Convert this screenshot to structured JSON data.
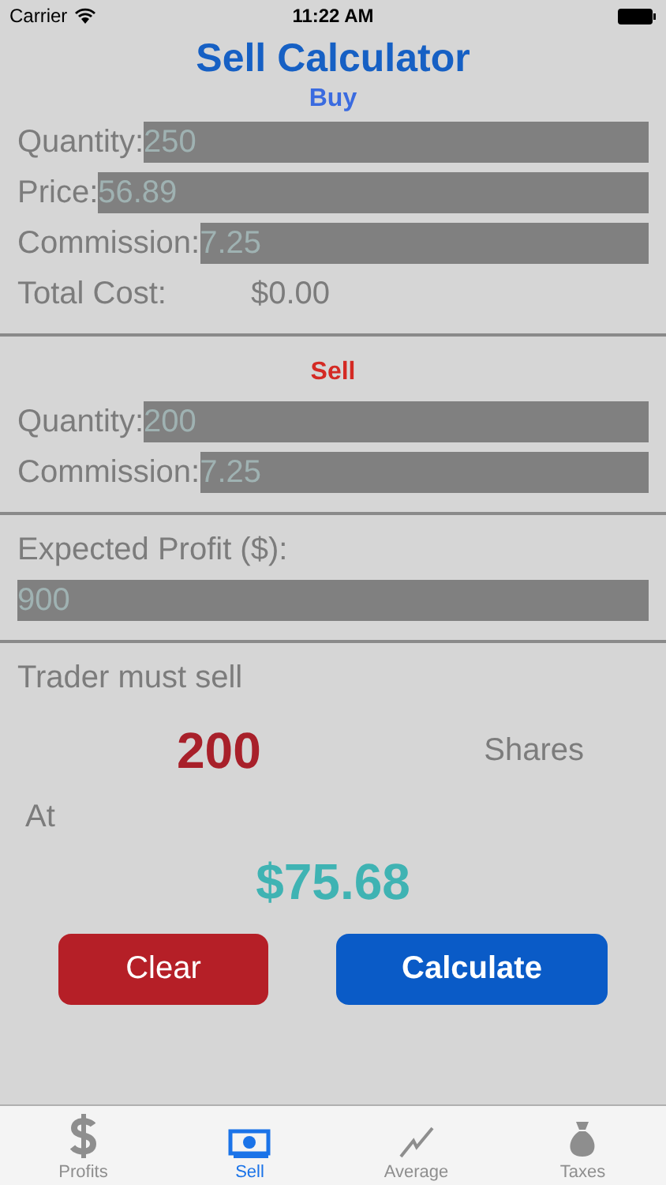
{
  "status_bar": {
    "carrier": "Carrier",
    "time": "11:22 AM"
  },
  "title": "Sell Calculator",
  "buy": {
    "heading": "Buy",
    "fields": [
      {
        "label": "Quantity:",
        "value": "250"
      },
      {
        "label": "Price:",
        "value": "56.89"
      },
      {
        "label": "Commission:",
        "value": "7.25"
      }
    ],
    "total_label": "Total Cost:",
    "total_value": "$0.00"
  },
  "sell": {
    "heading": "Sell",
    "fields": [
      {
        "label": "Quantity:",
        "value": "200"
      },
      {
        "label": "Commission:",
        "value": "7.25"
      }
    ]
  },
  "profit": {
    "label": "Expected Profit ($):",
    "value": "900"
  },
  "result": {
    "intro": "Trader must sell",
    "shares_value": "200",
    "shares_label": "Shares",
    "at_label": "At",
    "price": "$75.68"
  },
  "buttons": [
    {
      "label": "Clear",
      "kind": "clear"
    },
    {
      "label": "Calculate",
      "kind": "calculate"
    }
  ],
  "tabs": [
    {
      "label": "Profits",
      "kind": "dollar",
      "selected": false
    },
    {
      "label": "Sell",
      "kind": "banknote",
      "selected": true
    },
    {
      "label": "Average",
      "kind": "chart",
      "selected": false
    },
    {
      "label": "Taxes",
      "kind": "bag",
      "selected": false
    }
  ]
}
